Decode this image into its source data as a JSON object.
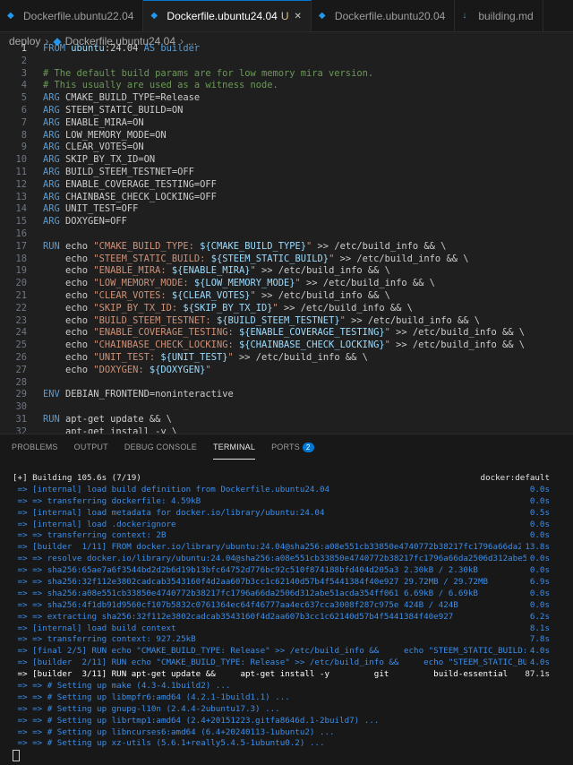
{
  "tabs": [
    {
      "label": "Dockerfile.ubuntu22.04",
      "active": false,
      "modified": "",
      "closable": false
    },
    {
      "label": "Dockerfile.ubuntu24.04",
      "active": true,
      "modified": "U",
      "closable": true
    },
    {
      "label": "Dockerfile.ubuntu20.04",
      "active": false,
      "modified": "",
      "closable": false
    },
    {
      "label": "building.md",
      "active": false,
      "modified": "",
      "closable": false
    }
  ],
  "breadcrumb": {
    "folder": "deploy",
    "file": "Dockerfile.ubuntu24.04",
    "more": "..."
  },
  "editor": {
    "current_line": 1,
    "lines": [
      [
        {
          "t": "FROM ",
          "c": "kw"
        },
        {
          "t": "ubuntu",
          "c": "var"
        },
        {
          "t": ":",
          "c": "def"
        },
        {
          "t": "24.04",
          "c": "def"
        },
        {
          "t": " AS builder",
          "c": "kw"
        }
      ],
      [],
      [
        {
          "t": "# The default build params are for low memory mira version.",
          "c": "cm"
        }
      ],
      [
        {
          "t": "# This usually are used as a witness node.",
          "c": "cm"
        }
      ],
      [
        {
          "t": "ARG ",
          "c": "kw"
        },
        {
          "t": "CMAKE_BUILD_TYPE=Release",
          "c": "def"
        }
      ],
      [
        {
          "t": "ARG ",
          "c": "kw"
        },
        {
          "t": "STEEM_STATIC_BUILD=ON",
          "c": "def"
        }
      ],
      [
        {
          "t": "ARG ",
          "c": "kw"
        },
        {
          "t": "ENABLE_MIRA=ON",
          "c": "def"
        }
      ],
      [
        {
          "t": "ARG ",
          "c": "kw"
        },
        {
          "t": "LOW_MEMORY_MODE=ON",
          "c": "def"
        }
      ],
      [
        {
          "t": "ARG ",
          "c": "kw"
        },
        {
          "t": "CLEAR_VOTES=ON",
          "c": "def"
        }
      ],
      [
        {
          "t": "ARG ",
          "c": "kw"
        },
        {
          "t": "SKIP_BY_TX_ID=ON",
          "c": "def"
        }
      ],
      [
        {
          "t": "ARG ",
          "c": "kw"
        },
        {
          "t": "BUILD_STEEM_TESTNET=OFF",
          "c": "def"
        }
      ],
      [
        {
          "t": "ARG ",
          "c": "kw"
        },
        {
          "t": "ENABLE_COVERAGE_TESTING=OFF",
          "c": "def"
        }
      ],
      [
        {
          "t": "ARG ",
          "c": "kw"
        },
        {
          "t": "CHAINBASE_CHECK_LOCKING=OFF",
          "c": "def"
        }
      ],
      [
        {
          "t": "ARG ",
          "c": "kw"
        },
        {
          "t": "UNIT_TEST=OFF",
          "c": "def"
        }
      ],
      [
        {
          "t": "ARG ",
          "c": "kw"
        },
        {
          "t": "DOXYGEN=OFF",
          "c": "def"
        }
      ],
      [],
      [
        {
          "t": "RUN ",
          "c": "kw"
        },
        {
          "t": "echo ",
          "c": "def"
        },
        {
          "t": "\"CMAKE_BUILD_TYPE: ",
          "c": "str"
        },
        {
          "t": "${CMAKE_BUILD_TYPE}",
          "c": "var"
        },
        {
          "t": "\"",
          "c": "str"
        },
        {
          "t": " >> /etc/build_info && \\",
          "c": "def"
        }
      ],
      [
        {
          "t": "    echo ",
          "c": "def"
        },
        {
          "t": "\"STEEM_STATIC_BUILD: ",
          "c": "str"
        },
        {
          "t": "${STEEM_STATIC_BUILD}",
          "c": "var"
        },
        {
          "t": "\"",
          "c": "str"
        },
        {
          "t": " >> /etc/build_info && \\",
          "c": "def"
        }
      ],
      [
        {
          "t": "    echo ",
          "c": "def"
        },
        {
          "t": "\"ENABLE_MIRA: ",
          "c": "str"
        },
        {
          "t": "${ENABLE_MIRA}",
          "c": "var"
        },
        {
          "t": "\"",
          "c": "str"
        },
        {
          "t": " >> /etc/build_info && \\",
          "c": "def"
        }
      ],
      [
        {
          "t": "    echo ",
          "c": "def"
        },
        {
          "t": "\"LOW_MEMORY_MODE: ",
          "c": "str"
        },
        {
          "t": "${LOW_MEMORY_MODE}",
          "c": "var"
        },
        {
          "t": "\"",
          "c": "str"
        },
        {
          "t": " >> /etc/build_info && \\",
          "c": "def"
        }
      ],
      [
        {
          "t": "    echo ",
          "c": "def"
        },
        {
          "t": "\"CLEAR_VOTES: ",
          "c": "str"
        },
        {
          "t": "${CLEAR_VOTES}",
          "c": "var"
        },
        {
          "t": "\"",
          "c": "str"
        },
        {
          "t": " >> /etc/build_info && \\",
          "c": "def"
        }
      ],
      [
        {
          "t": "    echo ",
          "c": "def"
        },
        {
          "t": "\"SKIP_BY_TX_ID: ",
          "c": "str"
        },
        {
          "t": "${SKIP_BY_TX_ID}",
          "c": "var"
        },
        {
          "t": "\"",
          "c": "str"
        },
        {
          "t": " >> /etc/build_info && \\",
          "c": "def"
        }
      ],
      [
        {
          "t": "    echo ",
          "c": "def"
        },
        {
          "t": "\"BUILD_STEEM_TESTNET: ",
          "c": "str"
        },
        {
          "t": "${BUILD_STEEM_TESTNET}",
          "c": "var"
        },
        {
          "t": "\"",
          "c": "str"
        },
        {
          "t": " >> /etc/build_info && \\",
          "c": "def"
        }
      ],
      [
        {
          "t": "    echo ",
          "c": "def"
        },
        {
          "t": "\"ENABLE_COVERAGE_TESTING: ",
          "c": "str"
        },
        {
          "t": "${ENABLE_COVERAGE_TESTING}",
          "c": "var"
        },
        {
          "t": "\"",
          "c": "str"
        },
        {
          "t": " >> /etc/build_info && \\",
          "c": "def"
        }
      ],
      [
        {
          "t": "    echo ",
          "c": "def"
        },
        {
          "t": "\"CHAINBASE_CHECK_LOCKING: ",
          "c": "str"
        },
        {
          "t": "${CHAINBASE_CHECK_LOCKING}",
          "c": "var"
        },
        {
          "t": "\"",
          "c": "str"
        },
        {
          "t": " >> /etc/build_info && \\",
          "c": "def"
        }
      ],
      [
        {
          "t": "    echo ",
          "c": "def"
        },
        {
          "t": "\"UNIT_TEST: ",
          "c": "str"
        },
        {
          "t": "${UNIT_TEST}",
          "c": "var"
        },
        {
          "t": "\"",
          "c": "str"
        },
        {
          "t": " >> /etc/build_info && \\",
          "c": "def"
        }
      ],
      [
        {
          "t": "    echo ",
          "c": "def"
        },
        {
          "t": "\"DOXYGEN: ",
          "c": "str"
        },
        {
          "t": "${DOXYGEN}",
          "c": "var"
        },
        {
          "t": "\"",
          "c": "str"
        }
      ],
      [],
      [
        {
          "t": "ENV ",
          "c": "kw"
        },
        {
          "t": "DEBIAN_FRONTEND=noninteractive",
          "c": "def"
        }
      ],
      [],
      [
        {
          "t": "RUN ",
          "c": "kw"
        },
        {
          "t": "apt-get update && \\",
          "c": "def"
        }
      ],
      [
        {
          "t": "    apt-get install -y \\",
          "c": "def"
        }
      ]
    ]
  },
  "panel": {
    "tabs": [
      {
        "label": "PROBLEMS",
        "active": false,
        "badge": ""
      },
      {
        "label": "OUTPUT",
        "active": false,
        "badge": ""
      },
      {
        "label": "DEBUG CONSOLE",
        "active": false,
        "badge": ""
      },
      {
        "label": "TERMINAL",
        "active": true,
        "badge": ""
      },
      {
        "label": "PORTS",
        "active": false,
        "badge": "2"
      }
    ]
  },
  "terminal": {
    "lines": [
      {
        "text": "[+] Building 105.6s (7/19)",
        "right": "docker:default",
        "color": "white"
      },
      {
        "text": " => [internal] load build definition from Dockerfile.ubuntu24.04",
        "right": "0.0s",
        "color": "blue"
      },
      {
        "text": " => => transferring dockerfile: 4.59kB",
        "right": "0.0s",
        "color": "blue"
      },
      {
        "text": " => [internal] load metadata for docker.io/library/ubuntu:24.04",
        "right": "0.5s",
        "color": "blue"
      },
      {
        "text": " => [internal] load .dockerignore",
        "right": "0.0s",
        "color": "blue"
      },
      {
        "text": " => => transferring context: 2B",
        "right": "0.0s",
        "color": "blue"
      },
      {
        "text": " => [builder  1/11] FROM docker.io/library/ubuntu:24.04@sha256:a08e551cb33850e4740772b38217fc1796a66da2",
        "right": "13.8s",
        "color": "blue"
      },
      {
        "text": " => => resolve docker.io/library/ubuntu:24.04@sha256:a08e551cb33850e4740772b38217fc1796a66da2506d312abe5",
        "right": "0.0s",
        "color": "blue"
      },
      {
        "text": " => => sha256:65ae7a6f3544bd2d2b6d19b13bfc64752d776bc92c510f874188bfd404d205a3 2.30kB / 2.30kB",
        "right": "0.0s",
        "color": "blue"
      },
      {
        "text": " => => sha256:32f112e3802cadcab3543160f4d2aa607b3cc1c62140d57b4f5441384f40e927 29.72MB / 29.72MB",
        "right": "6.9s",
        "color": "blue"
      },
      {
        "text": " => => sha256:a08e551cb33850e4740772b38217fc1796a66da2506d312abe51acda354ff061 6.69kB / 6.69kB",
        "right": "0.0s",
        "color": "blue"
      },
      {
        "text": " => => sha256:4f1db91d9560cf107b5832c0761364ec64f46777aa4ec637cca3008f287c975e 424B / 424B",
        "right": "0.0s",
        "color": "blue"
      },
      {
        "text": " => => extracting sha256:32f112e3802cadcab3543160f4d2aa607b3cc1c62140d57b4f5441384f40e927",
        "right": "6.2s",
        "color": "blue"
      },
      {
        "text": " => [internal] load build context",
        "right": "8.1s",
        "color": "blue"
      },
      {
        "text": " => => transferring context: 927.25kB",
        "right": "7.8s",
        "color": "blue"
      },
      {
        "text": " => [final 2/5] RUN echo \"CMAKE_BUILD_TYPE: Release\" >> /etc/build_info &&     echo \"STEEM_STATIC_BUILD:",
        "right": "4.0s",
        "color": "blue"
      },
      {
        "text": " => [builder  2/11] RUN echo \"CMAKE_BUILD_TYPE: Release\" >> /etc/build_info &&     echo \"STEEM_STATIC_BU",
        "right": "4.0s",
        "color": "blue"
      },
      {
        "text": " => [builder  3/11] RUN apt-get update &&     apt-get install -y         git         build-essential",
        "right": "87.1s",
        "color": "wbright"
      },
      {
        "text": " => => # Setting up make (4.3-4.1build2) ...",
        "right": "",
        "color": "blue"
      },
      {
        "text": " => => # Setting up libmpfr6:amd64 (4.2.1-1build1.1) ...",
        "right": "",
        "color": "blue"
      },
      {
        "text": " => => # Setting up gnupg-l10n (2.4.4-2ubuntu17.3) ...",
        "right": "",
        "color": "blue"
      },
      {
        "text": " => => # Setting up librtmp1:amd64 (2.4+20151223.gitfa8646d.1-2build7) ...",
        "right": "",
        "color": "blue"
      },
      {
        "text": " => => # Setting up libncurses6:amd64 (6.4+20240113-1ubuntu2) ...",
        "right": "",
        "color": "blue"
      },
      {
        "text": " => => # Setting up xz-utils (5.6.1+really5.4.5-1ubuntu0.2) ...",
        "right": "",
        "color": "blue"
      }
    ]
  }
}
